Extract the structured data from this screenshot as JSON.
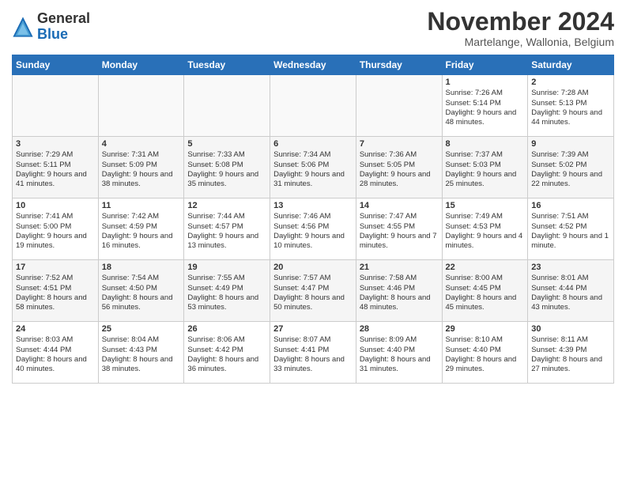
{
  "header": {
    "logo_line1": "General",
    "logo_line2": "Blue",
    "month": "November 2024",
    "location": "Martelange, Wallonia, Belgium"
  },
  "days_of_week": [
    "Sunday",
    "Monday",
    "Tuesday",
    "Wednesday",
    "Thursday",
    "Friday",
    "Saturday"
  ],
  "weeks": [
    [
      {
        "day": "",
        "info": ""
      },
      {
        "day": "",
        "info": ""
      },
      {
        "day": "",
        "info": ""
      },
      {
        "day": "",
        "info": ""
      },
      {
        "day": "",
        "info": ""
      },
      {
        "day": "1",
        "info": "Sunrise: 7:26 AM\nSunset: 5:14 PM\nDaylight: 9 hours and 48 minutes."
      },
      {
        "day": "2",
        "info": "Sunrise: 7:28 AM\nSunset: 5:13 PM\nDaylight: 9 hours and 44 minutes."
      }
    ],
    [
      {
        "day": "3",
        "info": "Sunrise: 7:29 AM\nSunset: 5:11 PM\nDaylight: 9 hours and 41 minutes."
      },
      {
        "day": "4",
        "info": "Sunrise: 7:31 AM\nSunset: 5:09 PM\nDaylight: 9 hours and 38 minutes."
      },
      {
        "day": "5",
        "info": "Sunrise: 7:33 AM\nSunset: 5:08 PM\nDaylight: 9 hours and 35 minutes."
      },
      {
        "day": "6",
        "info": "Sunrise: 7:34 AM\nSunset: 5:06 PM\nDaylight: 9 hours and 31 minutes."
      },
      {
        "day": "7",
        "info": "Sunrise: 7:36 AM\nSunset: 5:05 PM\nDaylight: 9 hours and 28 minutes."
      },
      {
        "day": "8",
        "info": "Sunrise: 7:37 AM\nSunset: 5:03 PM\nDaylight: 9 hours and 25 minutes."
      },
      {
        "day": "9",
        "info": "Sunrise: 7:39 AM\nSunset: 5:02 PM\nDaylight: 9 hours and 22 minutes."
      }
    ],
    [
      {
        "day": "10",
        "info": "Sunrise: 7:41 AM\nSunset: 5:00 PM\nDaylight: 9 hours and 19 minutes."
      },
      {
        "day": "11",
        "info": "Sunrise: 7:42 AM\nSunset: 4:59 PM\nDaylight: 9 hours and 16 minutes."
      },
      {
        "day": "12",
        "info": "Sunrise: 7:44 AM\nSunset: 4:57 PM\nDaylight: 9 hours and 13 minutes."
      },
      {
        "day": "13",
        "info": "Sunrise: 7:46 AM\nSunset: 4:56 PM\nDaylight: 9 hours and 10 minutes."
      },
      {
        "day": "14",
        "info": "Sunrise: 7:47 AM\nSunset: 4:55 PM\nDaylight: 9 hours and 7 minutes."
      },
      {
        "day": "15",
        "info": "Sunrise: 7:49 AM\nSunset: 4:53 PM\nDaylight: 9 hours and 4 minutes."
      },
      {
        "day": "16",
        "info": "Sunrise: 7:51 AM\nSunset: 4:52 PM\nDaylight: 9 hours and 1 minute."
      }
    ],
    [
      {
        "day": "17",
        "info": "Sunrise: 7:52 AM\nSunset: 4:51 PM\nDaylight: 8 hours and 58 minutes."
      },
      {
        "day": "18",
        "info": "Sunrise: 7:54 AM\nSunset: 4:50 PM\nDaylight: 8 hours and 56 minutes."
      },
      {
        "day": "19",
        "info": "Sunrise: 7:55 AM\nSunset: 4:49 PM\nDaylight: 8 hours and 53 minutes."
      },
      {
        "day": "20",
        "info": "Sunrise: 7:57 AM\nSunset: 4:47 PM\nDaylight: 8 hours and 50 minutes."
      },
      {
        "day": "21",
        "info": "Sunrise: 7:58 AM\nSunset: 4:46 PM\nDaylight: 8 hours and 48 minutes."
      },
      {
        "day": "22",
        "info": "Sunrise: 8:00 AM\nSunset: 4:45 PM\nDaylight: 8 hours and 45 minutes."
      },
      {
        "day": "23",
        "info": "Sunrise: 8:01 AM\nSunset: 4:44 PM\nDaylight: 8 hours and 43 minutes."
      }
    ],
    [
      {
        "day": "24",
        "info": "Sunrise: 8:03 AM\nSunset: 4:44 PM\nDaylight: 8 hours and 40 minutes."
      },
      {
        "day": "25",
        "info": "Sunrise: 8:04 AM\nSunset: 4:43 PM\nDaylight: 8 hours and 38 minutes."
      },
      {
        "day": "26",
        "info": "Sunrise: 8:06 AM\nSunset: 4:42 PM\nDaylight: 8 hours and 36 minutes."
      },
      {
        "day": "27",
        "info": "Sunrise: 8:07 AM\nSunset: 4:41 PM\nDaylight: 8 hours and 33 minutes."
      },
      {
        "day": "28",
        "info": "Sunrise: 8:09 AM\nSunset: 4:40 PM\nDaylight: 8 hours and 31 minutes."
      },
      {
        "day": "29",
        "info": "Sunrise: 8:10 AM\nSunset: 4:40 PM\nDaylight: 8 hours and 29 minutes."
      },
      {
        "day": "30",
        "info": "Sunrise: 8:11 AM\nSunset: 4:39 PM\nDaylight: 8 hours and 27 minutes."
      }
    ]
  ]
}
